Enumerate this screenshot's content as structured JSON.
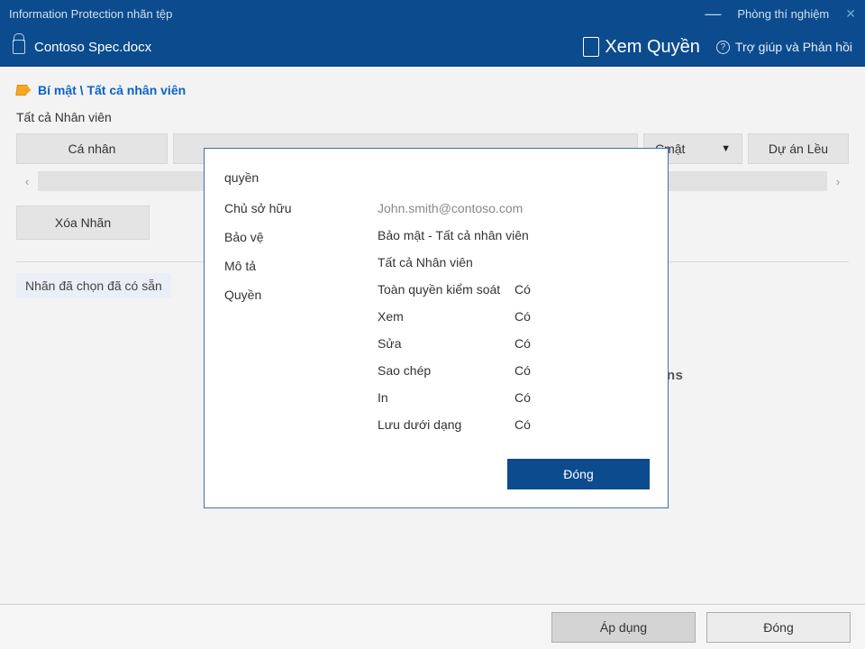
{
  "titlebar": {
    "app_title": "Information Protection nhãn tệp",
    "lab_label": "Phòng thí nghiệm"
  },
  "subbar": {
    "doc_name": "Contoso Spec.docx",
    "view_rights": "Xem Quyền",
    "help_feedback": "Trợ giúp và Phản hồi"
  },
  "panel": {
    "breadcrumb": "Bí mật \\ Tất cả nhân viên",
    "section_title": "Tất cả Nhân viên",
    "tab_personal": "Cá nhân",
    "tab_secret": "Cmật",
    "tab_project": "Dự án Lều",
    "delete_label": "Xóa Nhãn",
    "selected_note": "Nhãn đã chọn đã có sẵn",
    "bg_fragment": "ns"
  },
  "dialog": {
    "title": "quyền",
    "label_owner": "Chủ sở hữu",
    "label_protect": "Bảo vệ",
    "label_desc": "Mô tả",
    "label_rights": "Quyền",
    "owner_value": "John.smith@contoso.com",
    "protect_value": "Bảo mật - Tất cả nhân viên",
    "desc_value": "Tất cả Nhân viên",
    "perms": [
      {
        "name": "Toàn quyền kiểm soát",
        "val": "Có"
      },
      {
        "name": "Xem",
        "val": "Có"
      },
      {
        "name": "Sửa",
        "val": "Có"
      },
      {
        "name": "Sao chép",
        "val": "Có"
      },
      {
        "name": "In",
        "val": "Có"
      },
      {
        "name": "Lưu dưới dạng",
        "val": "Có"
      }
    ],
    "close_btn": "Đóng"
  },
  "footer": {
    "apply": "Áp dụng",
    "close": "Đóng"
  }
}
